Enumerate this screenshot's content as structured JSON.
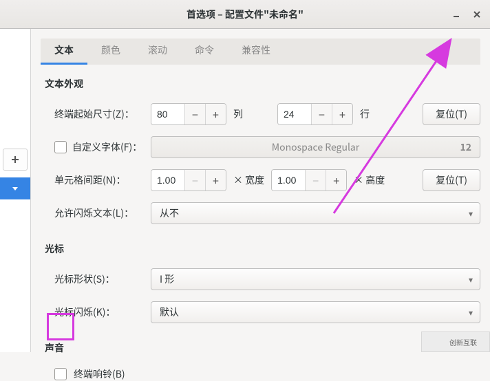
{
  "window": {
    "title": "首选项 – 配置文件\"未命名\""
  },
  "tabs": {
    "text": "文本",
    "color": "颜色",
    "scroll": "滚动",
    "command": "命令",
    "compat": "兼容性"
  },
  "sections": {
    "appearance": "文本外观",
    "cursor": "光标",
    "sound": "声音"
  },
  "labels": {
    "initial_size": "终端起始尺寸(Z)：",
    "cols": "列",
    "rows": "行",
    "custom_font": "自定义字体(F)：",
    "cell_spacing": "单元格间距(N)：",
    "width": "× 宽度",
    "height": "× 高度",
    "blink_text": "允许闪烁文本(L)：",
    "cursor_shape": "光标形状(S)：",
    "cursor_blink": "光标闪烁(K)：",
    "terminal_bell": "终端响铃(B)",
    "reset": "复位(T)"
  },
  "values": {
    "cols": "80",
    "rows": "24",
    "font_name": "Monospace Regular",
    "font_size": "12",
    "cell_w": "1.00",
    "cell_h": "1.00",
    "blink_text": "从不",
    "cursor_shape": "I 形",
    "cursor_blink": "默认"
  },
  "watermark": "创新互联"
}
